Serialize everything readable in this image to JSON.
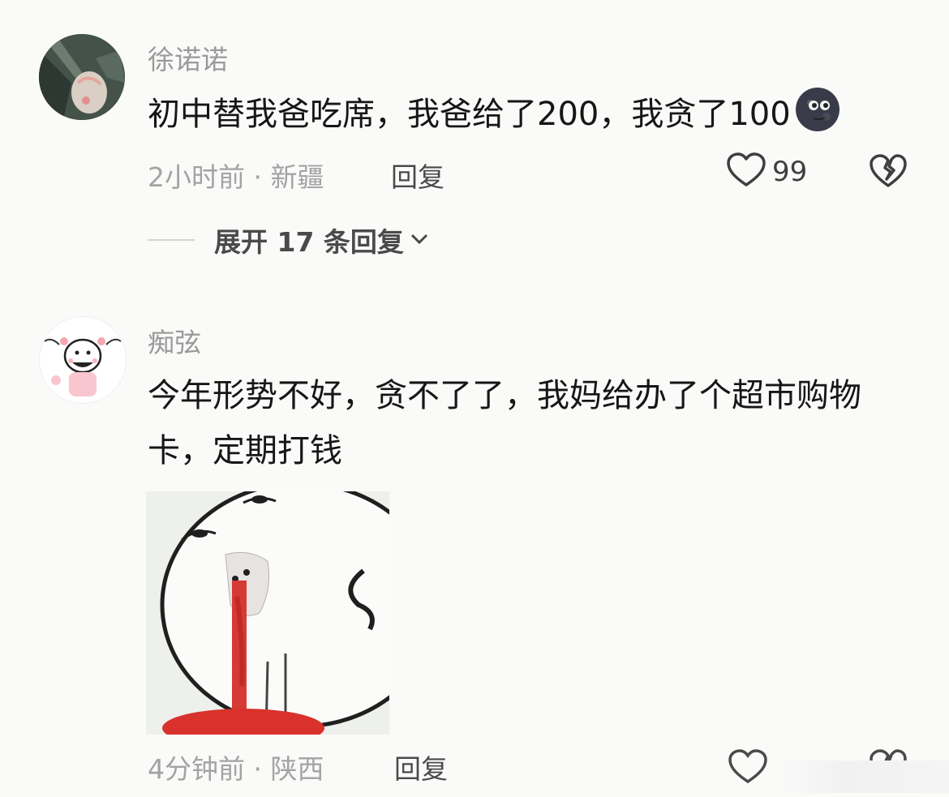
{
  "comments": [
    {
      "username": "徐诺诺",
      "text": "初中替我爸吃席，我爸给了200，我贪了100",
      "emoji": "new-moon-face-emoji",
      "time": "2小时前",
      "location": "新疆",
      "reply_label": "回复",
      "likes": "99",
      "expand_label": "展开 17 条回复"
    },
    {
      "username": "痴弦",
      "text": "今年形势不好，贪不了了，我妈给办了个超市购物卡，定期打钱",
      "time": "4分钟前",
      "location": "陕西",
      "reply_label": "回复"
    }
  ],
  "separator": "·"
}
